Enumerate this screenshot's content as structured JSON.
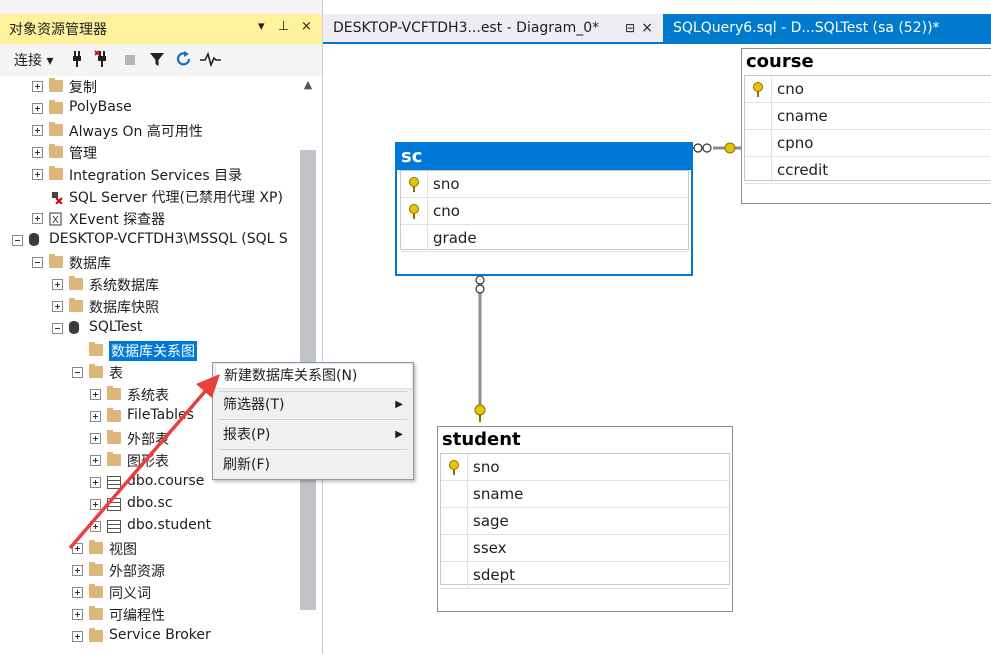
{
  "object_explorer": {
    "title": "对象资源管理器",
    "title_controls": [
      "▾",
      "⊥",
      "×"
    ],
    "toolbar": {
      "connect_label": "连接 ▾"
    },
    "tree": [
      {
        "label": "复制",
        "level": 2,
        "icon": "folder",
        "expander": "plus"
      },
      {
        "label": "PolyBase",
        "level": 2,
        "icon": "folder",
        "expander": "plus"
      },
      {
        "label": "Always On 高可用性",
        "level": 2,
        "icon": "folder",
        "expander": "plus"
      },
      {
        "label": "管理",
        "level": 2,
        "icon": "folder",
        "expander": "plus"
      },
      {
        "label": "Integration Services 目录",
        "level": 2,
        "icon": "folder",
        "expander": "plus"
      },
      {
        "label": "SQL Server 代理(已禁用代理 XP)",
        "level": 2,
        "icon": "agent",
        "expander": "none"
      },
      {
        "label": "XEvent 探查器",
        "level": 2,
        "icon": "xevent",
        "expander": "plus"
      },
      {
        "label": "DESKTOP-VCFTDH3\\MSSQL (SQL S",
        "level": 1,
        "icon": "server",
        "expander": "minus"
      },
      {
        "label": "数据库",
        "level": 2,
        "icon": "folder",
        "expander": "minus"
      },
      {
        "label": "系统数据库",
        "level": 3,
        "icon": "folder",
        "expander": "plus"
      },
      {
        "label": "数据库快照",
        "level": 3,
        "icon": "folder",
        "expander": "plus"
      },
      {
        "label": "SQLTest",
        "level": 3,
        "icon": "database",
        "expander": "minus"
      },
      {
        "label": "数据库关系图",
        "level": 4,
        "icon": "folder",
        "expander": "none",
        "selected": true
      },
      {
        "label": "表",
        "level": 4,
        "icon": "folder",
        "expander": "minus"
      },
      {
        "label": "系统表",
        "level": 5,
        "icon": "folder",
        "expander": "plus"
      },
      {
        "label": "FileTables",
        "level": 5,
        "icon": "folder",
        "expander": "plus"
      },
      {
        "label": "外部表",
        "level": 5,
        "icon": "folder",
        "expander": "plus"
      },
      {
        "label": "图形表",
        "level": 5,
        "icon": "folder",
        "expander": "plus"
      },
      {
        "label": "dbo.course",
        "level": 5,
        "icon": "table",
        "expander": "plus"
      },
      {
        "label": "dbo.sc",
        "level": 5,
        "icon": "table",
        "expander": "plus"
      },
      {
        "label": "dbo.student",
        "level": 5,
        "icon": "table",
        "expander": "plus"
      },
      {
        "label": "视图",
        "level": 4,
        "icon": "folder",
        "expander": "plus"
      },
      {
        "label": "外部资源",
        "level": 4,
        "icon": "folder",
        "expander": "plus"
      },
      {
        "label": "同义词",
        "level": 4,
        "icon": "folder",
        "expander": "plus"
      },
      {
        "label": "可编程性",
        "level": 4,
        "icon": "folder",
        "expander": "plus"
      },
      {
        "label": "Service Broker",
        "level": 4,
        "icon": "folder",
        "expander": "plus"
      }
    ]
  },
  "tabs": [
    {
      "label": "DESKTOP-VCFTDH3...est - Diagram_0*",
      "pin": "⊟",
      "close": "×",
      "active": false
    },
    {
      "label": "SQLQuery6.sql - D...SQLTest (sa (52))*",
      "active": true
    }
  ],
  "diagram": {
    "tables": {
      "course": {
        "name": "course",
        "columns": [
          {
            "name": "cno",
            "key": true
          },
          {
            "name": "cname",
            "key": false
          },
          {
            "name": "cpno",
            "key": false
          },
          {
            "name": "ccredit",
            "key": false
          }
        ]
      },
      "sc": {
        "name": "sc",
        "columns": [
          {
            "name": "sno",
            "key": true
          },
          {
            "name": "cno",
            "key": true
          },
          {
            "name": "grade",
            "key": false
          }
        ]
      },
      "student": {
        "name": "student",
        "columns": [
          {
            "name": "sno",
            "key": true
          },
          {
            "name": "sname",
            "key": false
          },
          {
            "name": "sage",
            "key": false
          },
          {
            "name": "ssex",
            "key": false
          },
          {
            "name": "sdept",
            "key": false
          }
        ]
      }
    }
  },
  "context_menu": {
    "items": [
      {
        "label": "新建数据库关系图(N)",
        "submenu": false,
        "highlighted": true
      },
      {
        "label": "筛选器(T)",
        "submenu": true
      },
      {
        "label": "报表(P)",
        "submenu": true
      },
      {
        "label": "刷新(F)",
        "submenu": false
      }
    ]
  },
  "colors": {
    "accent": "#007acc",
    "selection": "#0078d7",
    "title_highlight": "#fff29d",
    "annotation_arrow": "#e8403c",
    "folder": "#dcb67a"
  }
}
